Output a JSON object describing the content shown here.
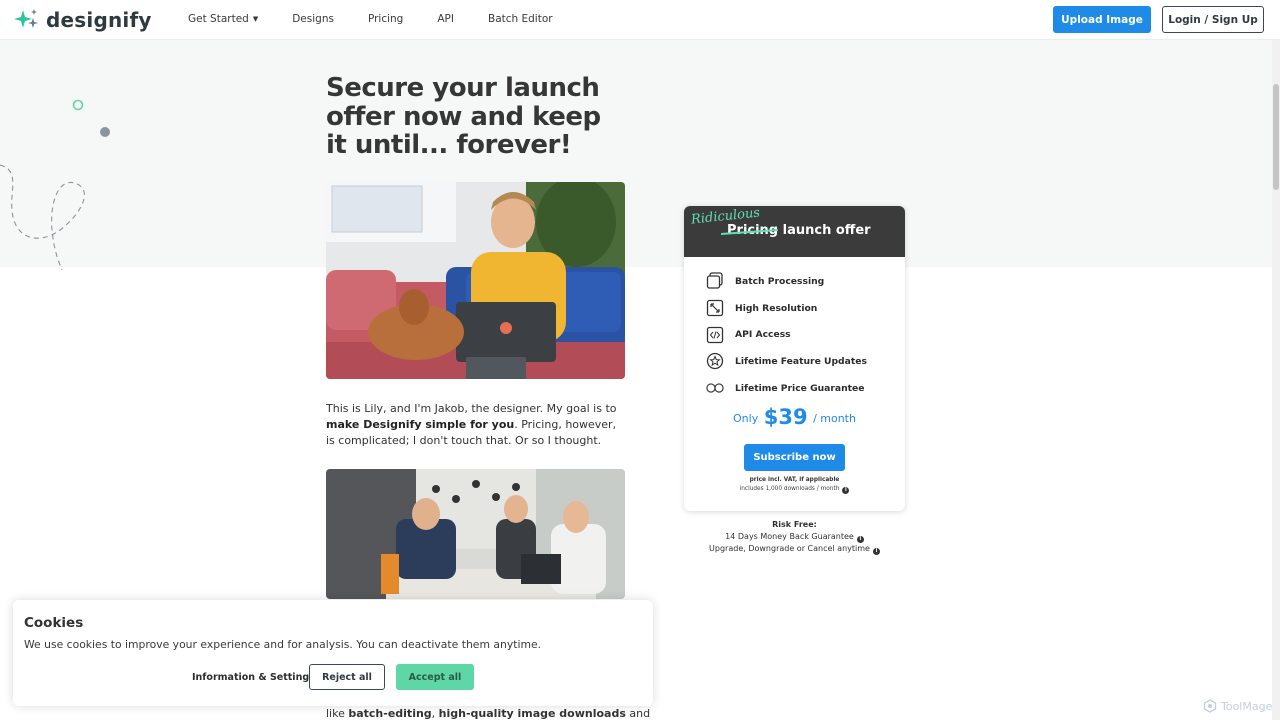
{
  "header": {
    "logo_text": "designify",
    "nav": [
      {
        "label": "Get Started"
      },
      {
        "label": "Designs"
      },
      {
        "label": "Pricing"
      },
      {
        "label": "API"
      },
      {
        "label": "Batch Editor"
      }
    ],
    "upload_label": "Upload Image",
    "login_label": "Login / Sign Up"
  },
  "main": {
    "headline": "Secure your launch offer now and keep it until... forever!",
    "intro": {
      "p1": "This is Lily, and I'm Jakob, the designer. My goal is to ",
      "bold": "make Designify simple for you",
      "p2": ". Pricing, however, is complicated; I don't touch that. Or so I thought."
    },
    "bottom": {
      "p1": "like ",
      "b1": "batch-editing",
      "p2": ", ",
      "b2": "high-quality image downloads",
      "p3": " and"
    }
  },
  "offer": {
    "ridiculous": "Ridiculous",
    "strike_word": "Pricing",
    "title_rest": " launch offer",
    "features": [
      {
        "icon": "layers-icon",
        "label": "Batch Processing"
      },
      {
        "icon": "resize-icon",
        "label": "High Resolution"
      },
      {
        "icon": "code-icon",
        "label": "API Access"
      },
      {
        "icon": "star-icon",
        "label": "Lifetime Feature Updates"
      },
      {
        "icon": "infinity-icon",
        "label": "Lifetime Price Guarantee"
      }
    ],
    "price_prefix": "Only",
    "price_amount": "$39",
    "price_suffix": "/ month",
    "subscribe_label": "Subscribe now",
    "fine_print_1": "price incl. VAT, if applicable",
    "fine_print_2": "includes 1,000 downloads / month"
  },
  "risk": {
    "title": "Risk Free:",
    "line1": "14 Days Money Back Guarantee",
    "line2": "Upgrade, Downgrade or Cancel anytime"
  },
  "cookies": {
    "title": "Cookies",
    "text": "We use cookies to improve your experience and for analysis. You can deactivate them anytime.",
    "info_label": "Information & Settings",
    "reject_label": "Reject all",
    "accept_label": "Accept all"
  },
  "watermark": "ToolMage",
  "colors": {
    "primary": "#1f8be8",
    "accent": "#5fd6a6",
    "dark": "#3b3b3b"
  }
}
